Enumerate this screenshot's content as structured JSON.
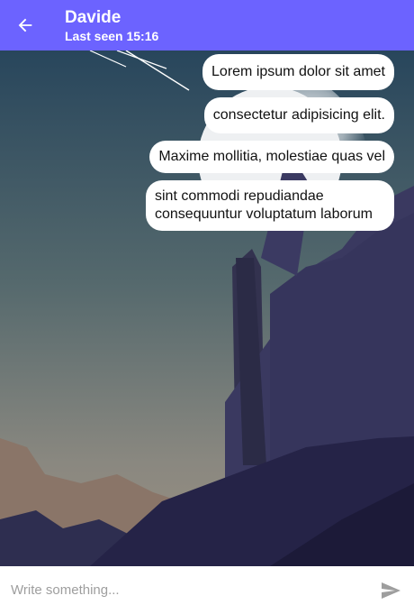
{
  "header": {
    "contact_name": "Davide",
    "last_seen": "Last seen 15:16",
    "back_icon": "arrow-left-icon",
    "color": "#6c63ff"
  },
  "messages": [
    {
      "text": "Lorem ipsum dolor sit amet",
      "side": "outgoing"
    },
    {
      "text": "consectetur adipisicing elit.",
      "side": "outgoing"
    },
    {
      "text": "Maxime mollitia, molestiae quas vel",
      "side": "outgoing"
    },
    {
      "text": "sint commodi repudiandae consequuntur voluptatum laborum",
      "side": "outgoing"
    }
  ],
  "composer": {
    "placeholder": "Write something...",
    "value": "",
    "send_icon": "send-icon"
  },
  "background": {
    "sky_top": "#2f4a5e",
    "sky_bottom": "#8b8a86",
    "mountain_dark": "#262648",
    "mountain_mid": "#3a3a62"
  }
}
